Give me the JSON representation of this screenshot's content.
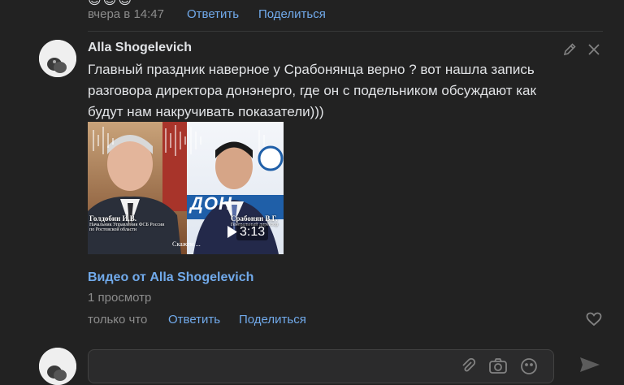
{
  "top_comment": {
    "emoji": "😊😊😊",
    "time": "вчера в 14:47",
    "reply_label": "Ответить",
    "share_label": "Поделиться"
  },
  "comment": {
    "author": "Alla Shogelevich",
    "text_lines": [
      "Главный праздник наверное у Срабонянца верно ? вот нашла запись",
      "разговора директора донэнерго, где он с подельником обсуждают как",
      "будут нам накручивать показатели)))"
    ],
    "video": {
      "left_caption_name": "Голдобин И.В.",
      "left_caption_role": "Начальник Управления ФСБ России по Ростовской области",
      "right_caption_name": "Срабонян В.Г.",
      "right_caption_role": "Генеральный директор",
      "subtitle": "Скажем ...",
      "logo_text": "ДОН",
      "duration": "3:13",
      "title": "Видео от Alla Shogelevich",
      "views": "1 просмотр"
    },
    "time": "только что",
    "reply_label": "Ответить",
    "share_label": "Поделиться"
  },
  "colors": {
    "background": "#222222",
    "link": "#71aaeb",
    "text": "#e1e3e6",
    "muted": "#8c8c8c"
  }
}
